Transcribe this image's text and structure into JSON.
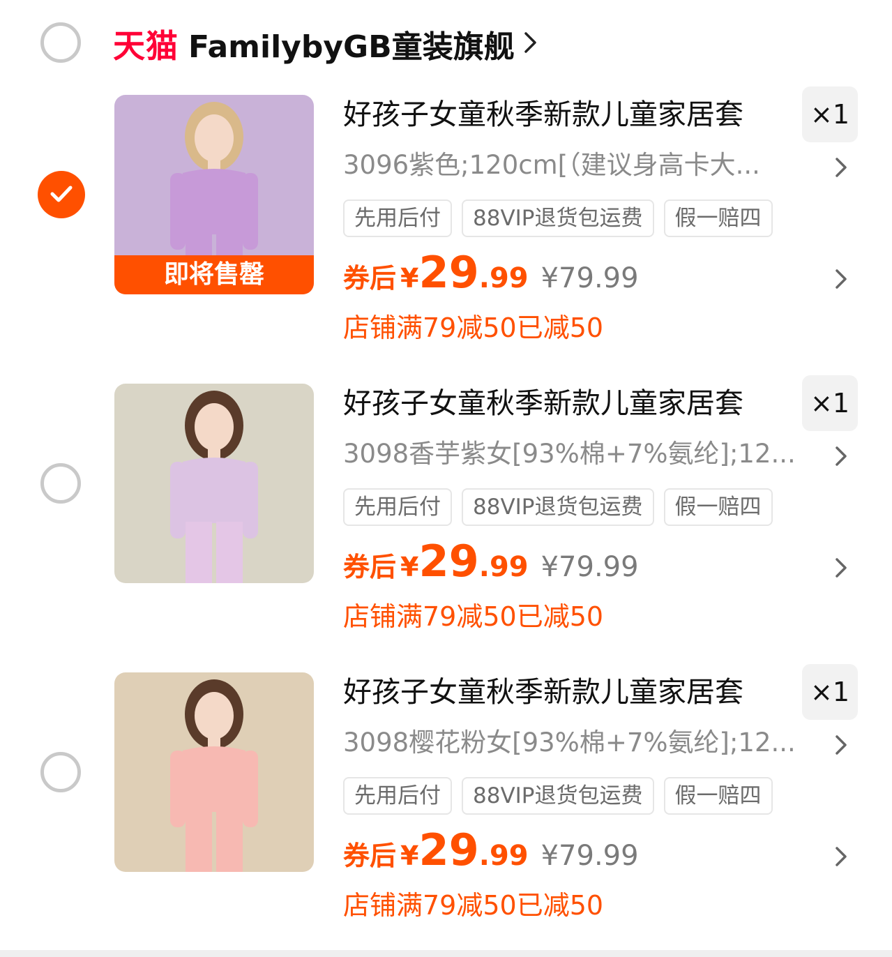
{
  "store": {
    "platform_logo": "天猫",
    "name": "FamilybyGB童装旗舰",
    "selected": false
  },
  "items": [
    {
      "selected": true,
      "title": "好孩子女童秋季新款儿童家居套",
      "quantity": "×1",
      "sku": "3096紫色;120cm[（建议身高卡大...",
      "badge": "即将售罄",
      "tags": [
        "先用后付",
        "88VIP退货包运费",
        "假一赔四"
      ],
      "price_prefix": "券后",
      "currency": "¥",
      "price_int": "29",
      "price_dec": ".99",
      "original_price": "¥79.99",
      "promo": "店铺满79减50已减50",
      "image": {
        "bg": "#c9b2d8",
        "top": "#c79ad8",
        "bottom": "#c79ad8",
        "hair": "#d9b98a"
      }
    },
    {
      "selected": false,
      "title": "好孩子女童秋季新款儿童家居套",
      "quantity": "×1",
      "sku": "3098香芋紫女[93%棉+7%氨纶];12...",
      "badge": "",
      "tags": [
        "先用后付",
        "88VIP退货包运费",
        "假一赔四"
      ],
      "price_prefix": "券后",
      "currency": "¥",
      "price_int": "29",
      "price_dec": ".99",
      "original_price": "¥79.99",
      "promo": "店铺满79减50已减50",
      "image": {
        "bg": "#d9d5c6",
        "top": "#dcc3e3",
        "bottom": "#e4c6e6",
        "hair": "#5a3b2a"
      }
    },
    {
      "selected": false,
      "title": "好孩子女童秋季新款儿童家居套",
      "quantity": "×1",
      "sku": "3098樱花粉女[93%棉+7%氨纶];12...",
      "badge": "",
      "tags": [
        "先用后付",
        "88VIP退货包运费",
        "假一赔四"
      ],
      "price_prefix": "券后",
      "currency": "¥",
      "price_int": "29",
      "price_dec": ".99",
      "original_price": "¥79.99",
      "promo": "店铺满79减50已减50",
      "image": {
        "bg": "#dfcfb6",
        "top": "#f7b9b2",
        "bottom": "#f7b9b2",
        "hair": "#5a3b2a"
      }
    }
  ],
  "colors": {
    "accent": "#ff5000",
    "tmall_red": "#ff0036",
    "muted_text": "#8a8a8a"
  }
}
